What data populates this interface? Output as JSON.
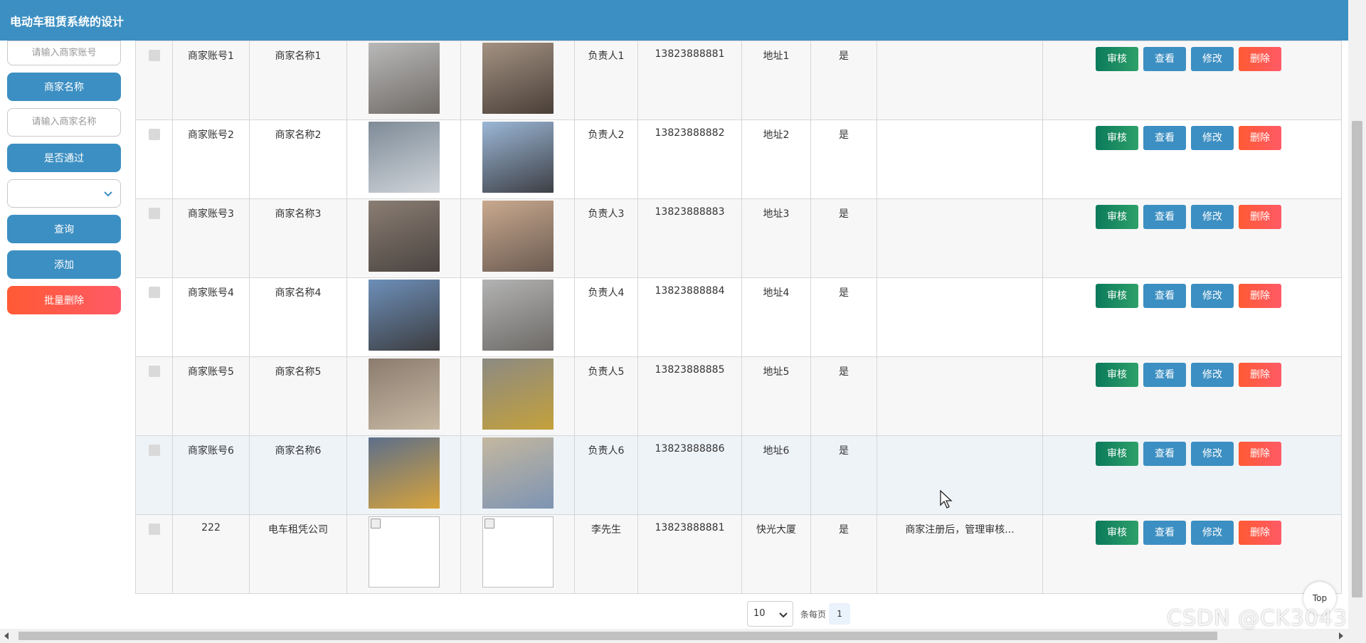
{
  "header": {
    "title": "电动车租赁系统的设计"
  },
  "sidebar": {
    "account_placeholder": "请输入商家账号",
    "name_label": "商家名称",
    "name_placeholder": "请输入商家名称",
    "passed_label": "是否通过",
    "passed_value": "",
    "search_button": "查询",
    "add_button": "添加",
    "batch_delete_button": "批量删除"
  },
  "colors": {
    "primary": "#3c8fc2",
    "danger": "#ff5a4a",
    "audit": "#0b7a5b"
  },
  "actions": {
    "audit": "审核",
    "view": "查看",
    "edit": "修改",
    "delete": "删除"
  },
  "rows": [
    {
      "account": "商家账号1",
      "name": "商家名称1",
      "leader": "负责人1",
      "phone": "13823888881",
      "address": "地址1",
      "passed": "是",
      "reply": ""
    },
    {
      "account": "商家账号2",
      "name": "商家名称2",
      "leader": "负责人2",
      "phone": "13823888882",
      "address": "地址2",
      "passed": "是",
      "reply": ""
    },
    {
      "account": "商家账号3",
      "name": "商家名称3",
      "leader": "负责人3",
      "phone": "13823888883",
      "address": "地址3",
      "passed": "是",
      "reply": ""
    },
    {
      "account": "商家账号4",
      "name": "商家名称4",
      "leader": "负责人4",
      "phone": "13823888884",
      "address": "地址4",
      "passed": "是",
      "reply": ""
    },
    {
      "account": "商家账号5",
      "name": "商家名称5",
      "leader": "负责人5",
      "phone": "13823888885",
      "address": "地址5",
      "passed": "是",
      "reply": ""
    },
    {
      "account": "商家账号6",
      "name": "商家名称6",
      "leader": "负责人6",
      "phone": "13823888886",
      "address": "地址6",
      "passed": "是",
      "reply": ""
    },
    {
      "account": "222",
      "name": "电车租凭公司",
      "leader": "李先生",
      "phone": "13823888881",
      "address": "快光大厦",
      "passed": "是",
      "reply": "商家注册后，管理审核..."
    }
  ],
  "pagination": {
    "page_size": "10",
    "per_page_label": "条每页",
    "current_page": "1"
  },
  "back_to_top": "Top",
  "watermark": "CSDN @CK3043"
}
